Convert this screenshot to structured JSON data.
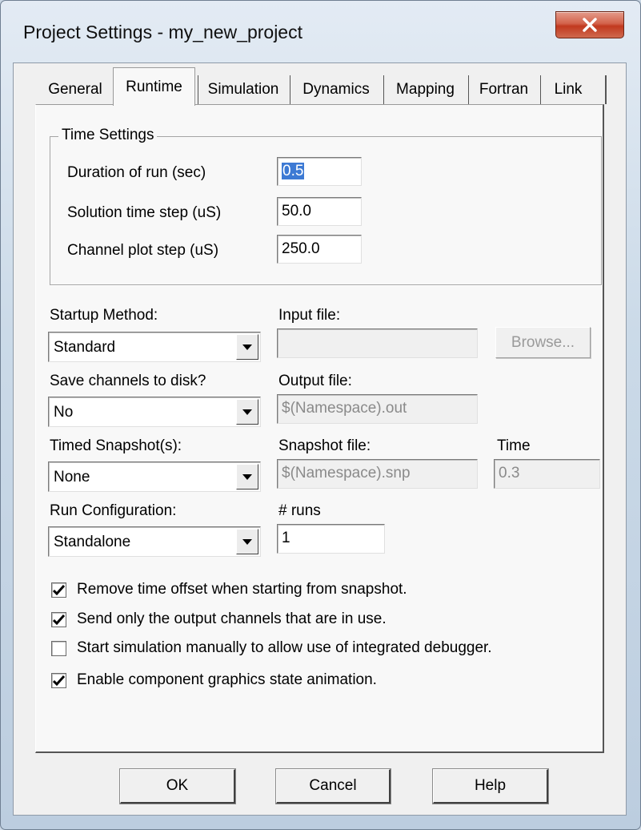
{
  "window": {
    "title": "Project Settings - my_new_project",
    "close_label": "x"
  },
  "tabs": [
    {
      "label": "General"
    },
    {
      "label": "Runtime"
    },
    {
      "label": "Simulation"
    },
    {
      "label": "Dynamics"
    },
    {
      "label": "Mapping"
    },
    {
      "label": "Fortran"
    },
    {
      "label": "Link"
    }
  ],
  "active_tab": "Runtime",
  "time_settings": {
    "title": "Time Settings",
    "duration_label": "Duration of run (sec)",
    "duration_value": "0.5",
    "timestep_label": "Solution time step (uS)",
    "timestep_value": "50.0",
    "plotstep_label": "Channel plot step (uS)",
    "plotstep_value": "250.0"
  },
  "startup": {
    "label": "Startup Method:",
    "value": "Standard"
  },
  "input_file": {
    "label": "Input file:",
    "value": ""
  },
  "browse": {
    "label": "Browse..."
  },
  "save_channels": {
    "label": "Save channels to disk?",
    "value": "No"
  },
  "output_file": {
    "label": "Output file:",
    "value": "$(Namespace).out"
  },
  "snapshot": {
    "label": "Timed Snapshot(s):",
    "value": "None"
  },
  "snapshot_file": {
    "label": "Snapshot file:",
    "value": "$(Namespace).snp"
  },
  "snapshot_time": {
    "label": "Time",
    "value": "0.3"
  },
  "run_config": {
    "label": "Run Configuration:",
    "value": "Standalone"
  },
  "num_runs": {
    "label": "# runs",
    "value": "1"
  },
  "options": [
    {
      "label": "Remove time offset when starting from snapshot.",
      "checked": true
    },
    {
      "label": "Send only the output channels that are in use.",
      "checked": true
    },
    {
      "label": "Start simulation manually to allow use of integrated debugger.",
      "checked": false
    },
    {
      "label": "Enable component graphics state animation.",
      "checked": true
    }
  ],
  "buttons": {
    "ok": "OK",
    "cancel": "Cancel",
    "help": "Help"
  },
  "icons": {
    "close": "close-icon",
    "dropdown": "chevron-down-icon",
    "check": "check-icon"
  },
  "colors": {
    "selection": "#3d7ad4",
    "close_button": "#c1391f",
    "panel": "#f8f8f8"
  }
}
